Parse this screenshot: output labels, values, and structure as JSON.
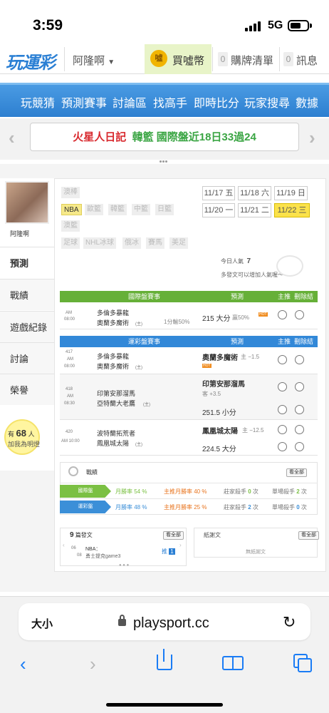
{
  "status": {
    "time": "3:59",
    "network": "5G"
  },
  "header": {
    "logo": "玩運彩",
    "user": "阿隆啊",
    "coin_icon": "噓",
    "coin_label": "買噓幣",
    "buy_list_count": "0",
    "buy_list_label": "購牌清單",
    "msg_count": "0",
    "msg_label": "訊息"
  },
  "nav": [
    "玩競猜",
    "預測賽事",
    "討論區",
    "找高手",
    "即時比分",
    "玩家搜尋",
    "數據"
  ],
  "banner": {
    "part1": "火星人日記",
    "part2": "韓籃 國際盤近18日33過24"
  },
  "sidebar": {
    "username": "阿隆啊",
    "tabs": [
      "預測",
      "戰績",
      "遊戲紀錄",
      "討論",
      "榮譽"
    ],
    "fans_prefix": "有",
    "fans_count": "68",
    "fans_suffix": "人",
    "fans_text": "加我為明燈"
  },
  "categories": {
    "row1": [
      "澳棒"
    ],
    "row2": [
      "NBA",
      "歐籃",
      "韓籃",
      "中籃",
      "日籃"
    ],
    "row3": [
      "澳籃"
    ],
    "row4": [
      "足球",
      "NHL冰球",
      "俄冰",
      "賽馬",
      "美足"
    ]
  },
  "dates": {
    "row1": [
      "11/17 五",
      "11/18 六",
      "11/19 日"
    ],
    "row2": [
      "11/20 一",
      "11/21 二",
      "11/22 三"
    ]
  },
  "popularity": {
    "label": "今日人氣",
    "value": "7",
    "tip": "多發文可以增加人氣喔～"
  },
  "intl_table": {
    "headers": [
      "國際盤賽事",
      "預測",
      "主推",
      "刪除",
      "結果"
    ],
    "rows": [
      {
        "time1": "AM",
        "time2": "08:00",
        "away": "多倫多暴龍",
        "home": "奧蘭多魔術",
        "home_tag": "(主)",
        "note": "1分輸50%",
        "pick": "215 大分",
        "pick_note": "贏50%",
        "hot": "HOT"
      }
    ]
  },
  "local_table": {
    "headers": [
      "運彩盤賽事",
      "預測",
      "主推",
      "刪除",
      "結果"
    ],
    "rows": [
      {
        "no": "417",
        "time1": "AM",
        "time2": "08:00",
        "away": "多倫多暴龍",
        "home": "奧蘭多魔術",
        "home_tag": "(主)",
        "pick1": "奧蘭多魔術",
        "pick1_note": "主 −1.5",
        "hot": "HOT"
      },
      {
        "no": "418",
        "time1": "AM",
        "time2": "08:30",
        "away": "印第安那溜馬",
        "home": "亞特蘭大老鷹",
        "home_tag": "(主)",
        "pick1": "印第安那溜馬",
        "pick1_note": "客 +3.5",
        "pick2": "251.5 小分"
      },
      {
        "no": "420",
        "time1": "AM 10:00",
        "away": "波特蘭拓荒者",
        "home": "鳳凰城太陽",
        "home_tag": "(主)",
        "pick1": "鳳凰城太陽",
        "pick1_note": "主 −12.5",
        "pick2": "224.5 大分"
      }
    ]
  },
  "record": {
    "title": "戰績",
    "view_all": "看全部",
    "rows": [
      {
        "tag": "國際盤",
        "rate_label": "月勝率",
        "rate": "54 %",
        "main_label": "主推月勝率",
        "main_rate": "40 %",
        "streak_label": "莊家殺手",
        "streak": "0",
        "unit": "次",
        "single_label": "單場殺手",
        "single": "2",
        "unit2": "次",
        "color": "#7bc043"
      },
      {
        "tag": "運彩盤",
        "rate_label": "月勝率",
        "rate": "48 %",
        "main_label": "主推月勝率",
        "main_rate": "25 %",
        "streak_label": "莊家殺手",
        "streak": "2",
        "unit": "次",
        "single_label": "單場殺手",
        "single": "0",
        "unit2": "次",
        "color": "#3b8fd8"
      }
    ]
  },
  "posts": {
    "count": "9",
    "label": "篇發文",
    "view_all": "看全部",
    "item_date1": "06",
    "item_date2": "08",
    "item_cat": "NBA：",
    "item_title": "勇士提克game3",
    "item_tag": "推",
    "item_count": "1"
  },
  "replies": {
    "label": "紙謝文",
    "view_all": "看全部",
    "empty": "無紙謝文"
  },
  "browser": {
    "aa": "大小",
    "url": "playsport.cc"
  }
}
